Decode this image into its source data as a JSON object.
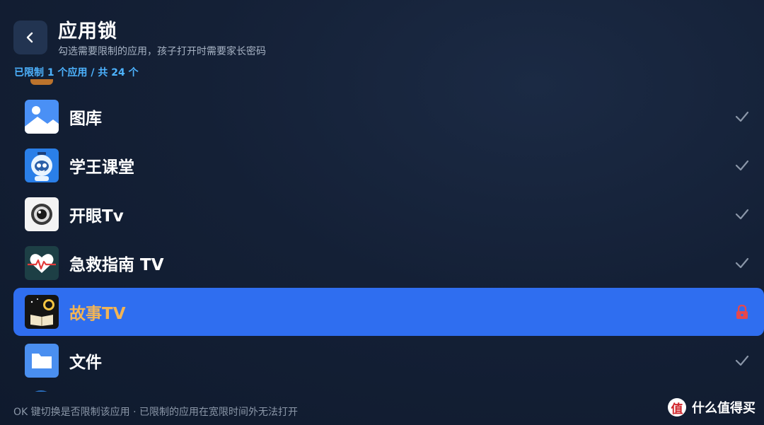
{
  "header": {
    "title": "应用锁",
    "subtitle": "勾选需要限制的应用，孩子打开时需要家长密码",
    "count_text": "已限制 1 个应用 / 共 24 个"
  },
  "apps": [
    {
      "name": "图库",
      "icon": "gallery-icon",
      "status": "check"
    },
    {
      "name": "学王课堂",
      "icon": "robot-mascot-icon",
      "status": "check"
    },
    {
      "name": "开眼Tv",
      "icon": "eye-icon",
      "status": "check"
    },
    {
      "name": "急救指南 TV",
      "icon": "heart-pulse-icon",
      "status": "check"
    },
    {
      "name": "故事TV",
      "icon": "moon-book-icon",
      "status": "locked",
      "selected": true
    },
    {
      "name": "文件",
      "icon": "folder-icon",
      "status": "check"
    }
  ],
  "footer": {
    "hint": "OK 键切换是否限制该应用 · 已限制的应用在宽限时间外无法打开"
  },
  "watermark": {
    "logo": "值",
    "text": "什么值得买"
  },
  "colors": {
    "accent": "#2f6ef0",
    "count_text": "#4db3ff",
    "selected_name": "#f2b455",
    "lock": "#e5484d",
    "check": "#8a96a8"
  }
}
